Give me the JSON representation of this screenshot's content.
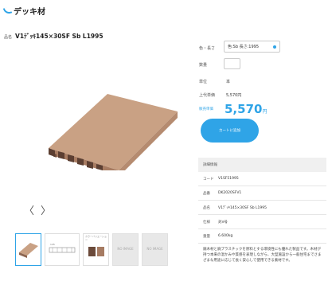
{
  "header": {
    "category_title": "デッキ材"
  },
  "product": {
    "label": "品名",
    "title": "V1ﾃﾞｯｷ145×30SF Sb L1995"
  },
  "gallery": {
    "prev_label": "〈",
    "next_label": "〉",
    "thumbnails": [
      {
        "kind": "photo"
      },
      {
        "kind": "dimension",
        "caption": "145"
      },
      {
        "kind": "swatches",
        "caption": "カラーバリエーション"
      },
      {
        "kind": "noimage",
        "caption": "NO IMAGE"
      },
      {
        "kind": "noimage",
        "caption": "NO IMAGE"
      }
    ]
  },
  "form": {
    "color_label": "色・長さ",
    "color_value": "色:Sb 長さ:1995",
    "qty_label": "数量",
    "qty_value": "",
    "unit_label": "単位",
    "unit_value": "本",
    "list_price_label": "上代単価",
    "list_price_value": "5,570円",
    "sale_label": "販売単価",
    "sale_price": "5,570",
    "sale_currency": "円",
    "cart_button": "カートに追加"
  },
  "details": {
    "header": "詳細情報",
    "rows": [
      {
        "key": "コード",
        "value": "V1SF51995"
      },
      {
        "key": "品番",
        "value": "DK2020SFV1"
      },
      {
        "key": "品名",
        "value": "V1ﾃﾞｯｷ145×30SF Sb L1995"
      },
      {
        "key": "仕様",
        "value": "対л号"
      },
      {
        "key": "重量",
        "value": "6.600kg"
      }
    ],
    "description": "廃木材と廃プラスチックを原料とする環境性にも優れた製品です。木材が持つ本来の温かみや質感を表現しながら、大型施設から一般住宅までさまざまな用途に応じて長く安心して使用できる素材です。"
  },
  "colors": {
    "accent": "#2fa4e7",
    "wood": "#c49a7c",
    "wood_dark": "#9a6f55",
    "swatch_a": "#6b4a3a",
    "swatch_b": "#a67b62"
  }
}
